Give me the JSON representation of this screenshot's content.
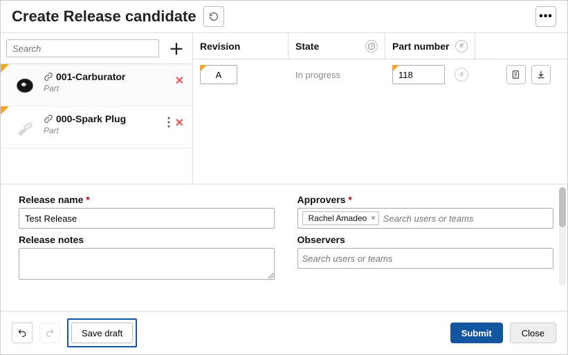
{
  "header": {
    "title": "Create Release candidate"
  },
  "sidebar": {
    "search_placeholder": "Search",
    "items": [
      {
        "name": "001-Carburator",
        "type": "Part",
        "thumb": "carburator"
      },
      {
        "name": "000-Spark Plug",
        "type": "Part",
        "thumb": "sparkplug"
      }
    ]
  },
  "grid": {
    "columns": {
      "revision": "Revision",
      "state": "State",
      "part_number": "Part number"
    },
    "row": {
      "revision": "A",
      "state": "In progress",
      "part_number": "118"
    }
  },
  "form": {
    "release_name_label": "Release name",
    "release_name_value": "Test Release",
    "release_notes_label": "Release notes",
    "release_notes_value": "",
    "approvers_label": "Approvers",
    "approvers_tags": [
      "Rachel Amadeo"
    ],
    "approvers_placeholder": "Search users or teams",
    "observers_label": "Observers",
    "observers_placeholder": "Search users or teams"
  },
  "footer": {
    "save_draft": "Save draft",
    "submit": "Submit",
    "close": "Close"
  }
}
